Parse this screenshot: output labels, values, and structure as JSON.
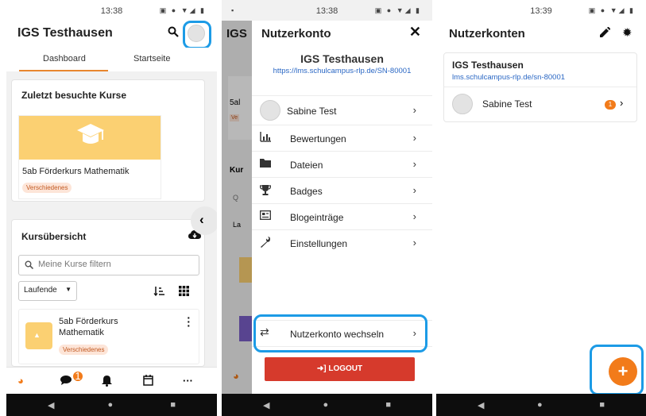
{
  "status_icons": "▣ ● ▼◢ ▮",
  "nav": {
    "back": "◀",
    "home": "●",
    "recent": "■"
  },
  "screen1": {
    "time": "13:38",
    "title": "IGS Testhausen",
    "tabs": [
      "Dashboard",
      "Startseite"
    ],
    "recent_courses_title": "Zuletzt besuchte Kurse",
    "recent_course": {
      "name": "5ab Förderkurs Mathematik",
      "badge": "Verschiedenes"
    },
    "overview_title": "Kursübersicht",
    "filter_placeholder": "Meine Kurse filtern",
    "select_value": "Laufende",
    "course_item": {
      "name": "5ab Förderkurs Mathematik",
      "badge": "Verschiedenes"
    },
    "messages_count": "1"
  },
  "screen2": {
    "time": "13:38",
    "bg_title": "IGS",
    "title": "Nutzerkonto",
    "site_name": "IGS Testhausen",
    "site_url": "https://lms.schulcampus-rlp.de/SN-80001",
    "user_name": "Sabine Test",
    "menu": [
      "Bewertungen",
      "Dateien",
      "Badges",
      "Blogeinträge",
      "Einstellungen"
    ],
    "switch_account": "Nutzerkonto wechseln",
    "logout": "LOGOUT",
    "bg_text": [
      "5al",
      "Ve",
      "Kur",
      "Q",
      "La"
    ]
  },
  "screen3": {
    "time": "13:39",
    "title": "Nutzerkonten",
    "site_name": "IGS Testhausen",
    "site_url": "lms.schulcampus-rlp.de/sn-80001",
    "user_name": "Sabine Test",
    "count": "1"
  }
}
